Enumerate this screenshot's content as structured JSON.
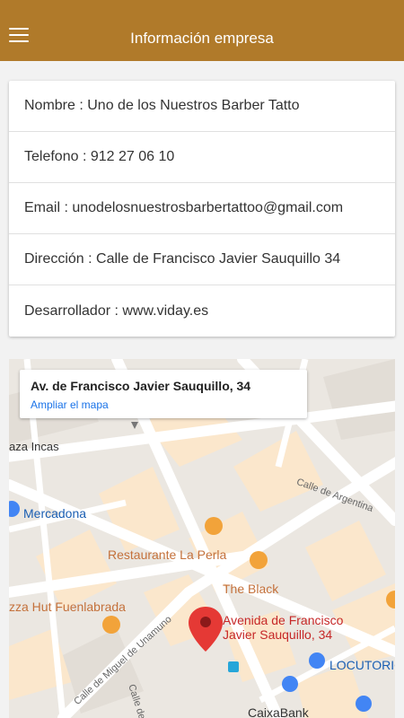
{
  "header": {
    "title": "Información empresa",
    "menu_icon": "hamburger-menu-icon"
  },
  "info": {
    "nombre": "Nombre : Uno de los Nuestros Barber Tatto",
    "telefono": "Telefono : 912 27 06 10",
    "email": "Email : unodelosnuestrosbarbertattoo@gmail.com",
    "direccion": "Dirección : Calle de Francisco Javier Sauquillo 34",
    "desarrollador": "Desarrollador : www.viday.es"
  },
  "map": {
    "card_address": "Av. de Francisco Javier Sauquillo, 34",
    "card_link": "Ampliar el mapa",
    "pin_label_line1": "Avenida de Francisco",
    "pin_label_line2": "Javier Sauquillo, 34",
    "places": {
      "plaza": "aza Incas",
      "mercadona": "Mercadona",
      "restaurante": "Restaurante La Perla",
      "black": "The Black",
      "pizza": "zza Hut Fuenlabrada",
      "locutorio": "LOCUTORIO",
      "caixa": "CaixaBank"
    },
    "streets": {
      "argentina": "Calle de Argentina",
      "miguel": "Calle de Miguel de Unamuno",
      "calle_de": "Calle de"
    }
  }
}
